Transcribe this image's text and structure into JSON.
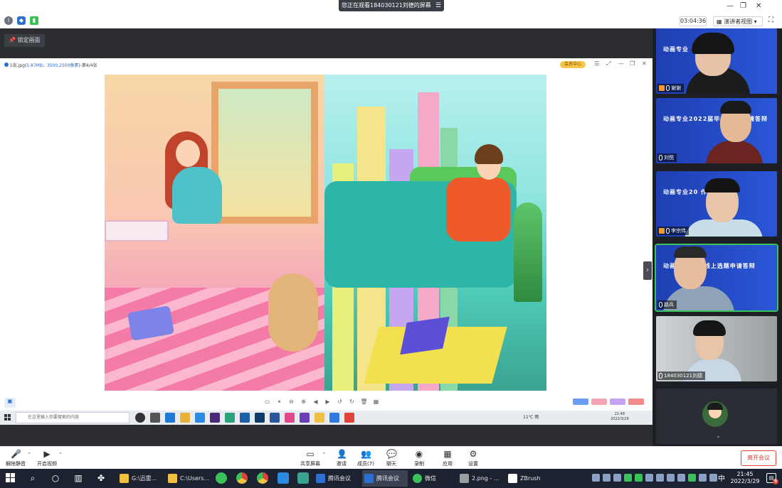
{
  "meeting": {
    "banner_text": "您正在观看184030121刘德的屏幕",
    "banner_menu_icon": "menu-icon",
    "timer": "03:04:36",
    "view_mode": "演讲者视图",
    "view_mode_caret": "▾",
    "lock_screen": "锁定画面",
    "leave_button": "离开会议"
  },
  "viewer": {
    "file_prefix": "1张.jpg(",
    "file_size": "5.87MB",
    "separator": "、",
    "dimensions": "3500,2500像素",
    "index": ")-第4/4张",
    "vip_label": "会员中心"
  },
  "inner_taskbar": {
    "search_placeholder": "在这里输入你要搜索的内容",
    "tray_text": "11℃ 雨",
    "time": "21:48",
    "date": "2022/3/29"
  },
  "participants": [
    {
      "name": "谢谢",
      "slide": "动画专业             选题申请答辩",
      "active": false
    },
    {
      "name": "刘悦",
      "slide": "动画专业2022届毕业    选题申请答辩",
      "active": false
    },
    {
      "name": "李宗伟",
      "slide": "动画专业20           作布置会",
      "active": false
    },
    {
      "name": "路兵",
      "slide": "动画专业    业生线上选题申请答辩",
      "active": true
    },
    {
      "name": "184030121刘德",
      "slide": "",
      "active": false
    }
  ],
  "controls": {
    "mute": "解除静音",
    "video": "开启视频",
    "share": "共享屏幕",
    "invite": "邀请",
    "members": "成员(7)",
    "chat": "聊天",
    "record": "录制",
    "apps": "应用",
    "settings": "设置"
  },
  "taskbar": {
    "tasks": [
      "G:\\迅雷...",
      "C:\\Users...",
      "腾讯会议",
      "腾讯会议",
      "微信",
      "2.png - ...",
      "ZBrush"
    ],
    "time": "21:45",
    "date": "2022/3/29",
    "ime": "中",
    "notification_count": "5"
  },
  "colors": {
    "accent_green": "#39c15a",
    "leave_red": "#e0433b",
    "link_blue": "#2c6fd1",
    "slide_blue": "#1f3fb3"
  }
}
